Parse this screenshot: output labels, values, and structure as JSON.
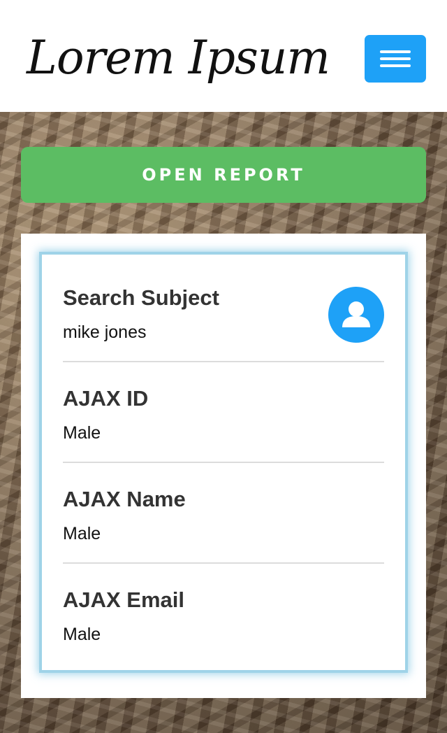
{
  "header": {
    "logo_text": "Lorem Ipsum",
    "menu_icon": "hamburger-icon"
  },
  "actions": {
    "open_report_label": "OPEN REPORT"
  },
  "report": {
    "fields": [
      {
        "label": "Search Subject",
        "value": "mike jones"
      },
      {
        "label": "AJAX ID",
        "value": "Male"
      },
      {
        "label": "AJAX Name",
        "value": "Male"
      },
      {
        "label": "AJAX Email",
        "value": "Male"
      }
    ],
    "avatar_icon": "user-avatar-icon"
  },
  "colors": {
    "accent_blue": "#1ea1f7",
    "button_green": "#5cbd63",
    "card_border": "#9fd3e8"
  }
}
